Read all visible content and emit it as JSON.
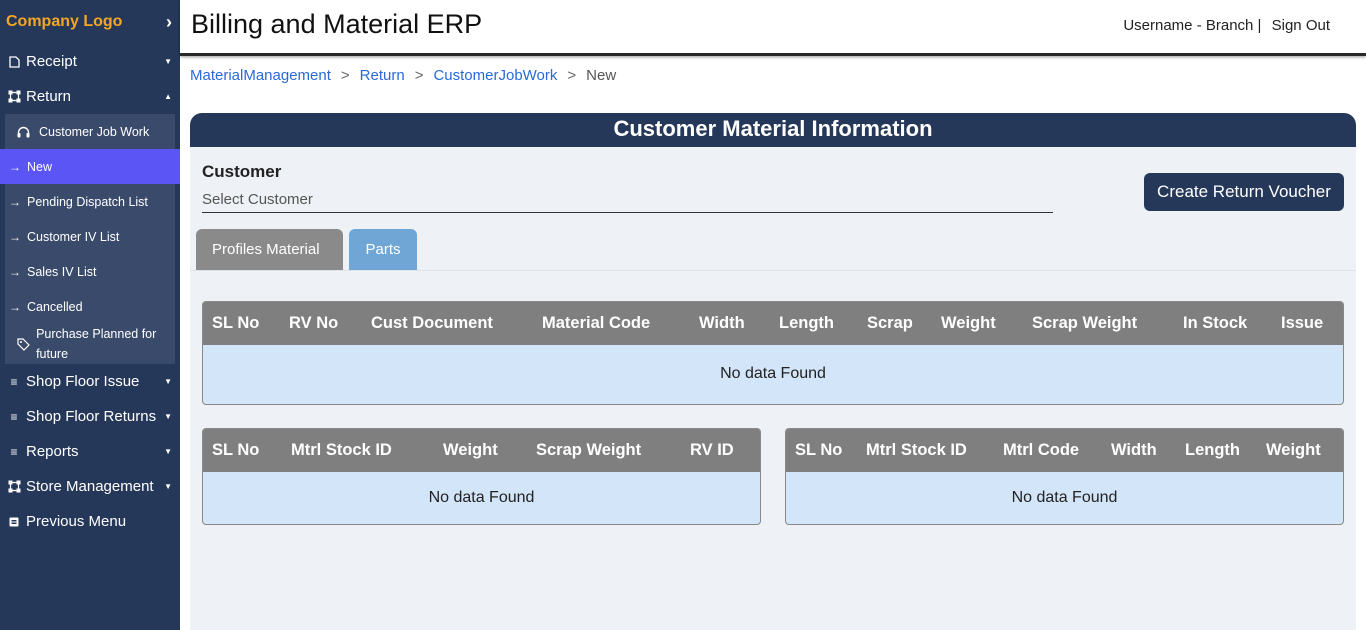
{
  "sidebar": {
    "logo": "Company Logo",
    "items": [
      {
        "label": "Receipt"
      },
      {
        "label": "Return"
      },
      {
        "label": "Shop Floor Issue"
      },
      {
        "label": "Shop Floor Returns"
      },
      {
        "label": "Reports"
      },
      {
        "label": "Store Management"
      },
      {
        "label": "Previous Menu"
      }
    ],
    "return_sub": {
      "heading": "Customer Job Work",
      "items": [
        {
          "label": "New"
        },
        {
          "label": "Pending Dispatch List"
        },
        {
          "label": "Customer IV List"
        },
        {
          "label": "Sales IV List"
        },
        {
          "label": "Cancelled"
        }
      ],
      "purchase": "Purchase Planned for future"
    }
  },
  "header": {
    "title": "Billing and Material ERP",
    "user": "Username - Branch |",
    "signout": "Sign Out"
  },
  "breadcrumb": {
    "items": [
      "MaterialManagement",
      "Return",
      "CustomerJobWork"
    ],
    "current": "New",
    "sep": ">"
  },
  "panel": {
    "title": "Customer Material Information",
    "customer_label": "Customer",
    "customer_placeholder": "Select Customer",
    "create_button": "Create Return Voucher",
    "tabs": [
      "Profiles Material",
      "Parts"
    ]
  },
  "tables": {
    "main": {
      "headers": [
        "SL No",
        "RV No",
        "Cust Document",
        "Material Code",
        "Width",
        "Length",
        "Scrap",
        "Weight",
        "Scrap Weight",
        "In Stock",
        "Issue"
      ],
      "empty": "No data Found"
    },
    "left": {
      "headers": [
        "SL No",
        "Mtrl Stock ID",
        "Weight",
        "Scrap Weight",
        "RV ID"
      ],
      "empty": "No data Found"
    },
    "right": {
      "headers": [
        "SL No",
        "Mtrl Stock ID",
        "Mtrl Code",
        "Width",
        "Length",
        "Weight"
      ],
      "empty": "No data Found"
    }
  }
}
